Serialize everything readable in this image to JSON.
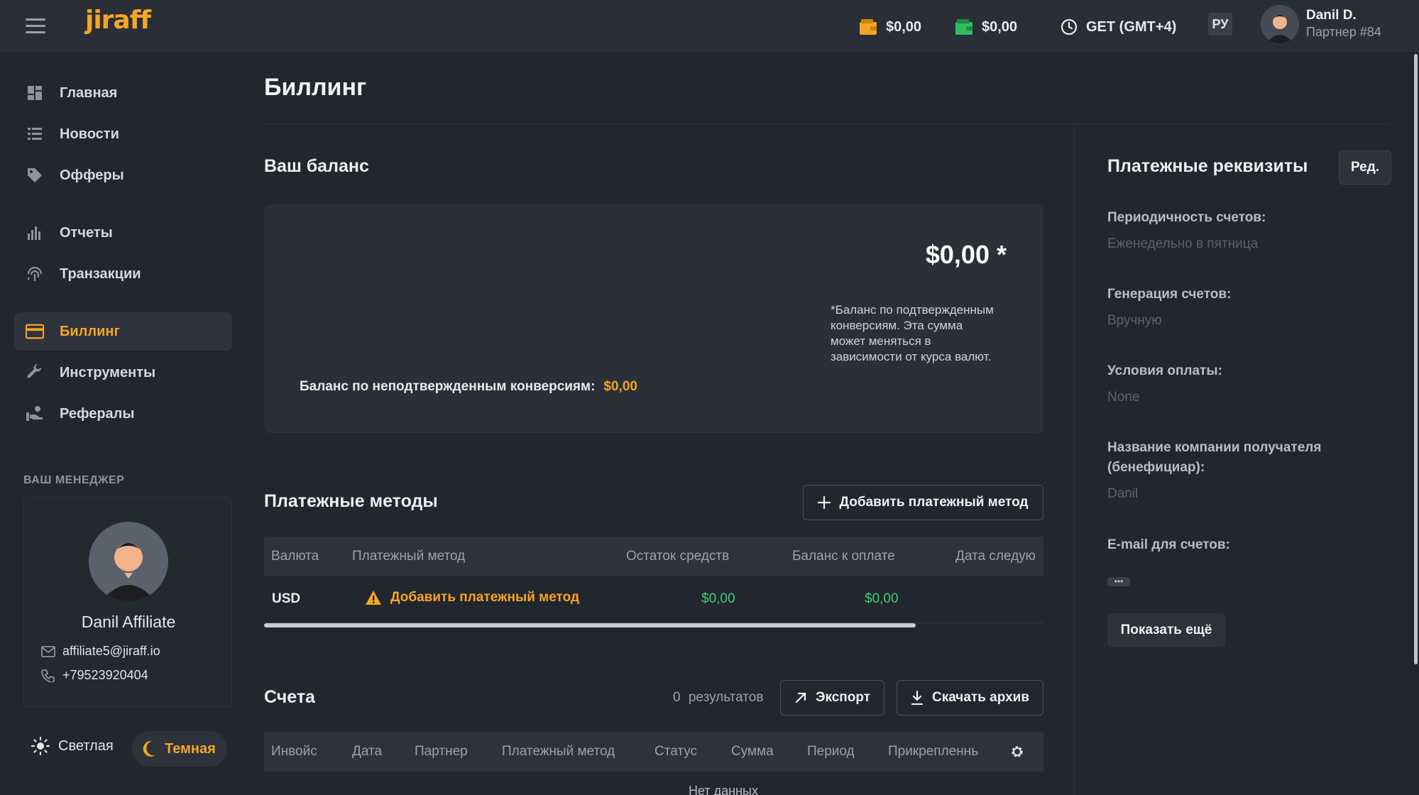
{
  "header": {
    "logo": "jiraff",
    "wallet1_amount": "$0,00",
    "wallet2_amount": "$0,00",
    "timezone": "GET (GMT+4)",
    "lang": "РУ",
    "user_name": "Danil D.",
    "user_role": "Партнер #84"
  },
  "sidebar": {
    "items": [
      {
        "label": "Главная",
        "icon": "dashboard-icon"
      },
      {
        "label": "Новости",
        "icon": "news-icon"
      },
      {
        "label": "Офферы",
        "icon": "tag-icon"
      },
      {
        "label": "Отчеты",
        "icon": "bar-chart-icon"
      },
      {
        "label": "Транзакции",
        "icon": "fingerprint-icon"
      },
      {
        "label": "Биллинг",
        "icon": "credit-card-icon",
        "active": true
      },
      {
        "label": "Инструменты",
        "icon": "wrench-icon"
      },
      {
        "label": "Рефералы",
        "icon": "referral-icon"
      }
    ],
    "manager_title": "ВАШ МЕНЕДЖЕР",
    "manager": {
      "name": "Danil Affiliate",
      "email": "affiliate5@jiraff.io",
      "phone": "+79523920404"
    },
    "theme_light": "Светлая",
    "theme_dark": "Темная"
  },
  "main": {
    "page_title": "Биллинг",
    "balance": {
      "title": "Ваш баланс",
      "amount": "$0,00 *",
      "note": "*Баланс по подтвержденным конверсиям. Эта сумма может меняться в зависимости от курса валют.",
      "unconfirmed_label": "Баланс по неподтвержденным конверсиям:",
      "unconfirmed_value": "$0,00"
    },
    "payment_methods": {
      "title": "Платежные методы",
      "add_button": "Добавить платежный метод",
      "columns": [
        "Валюта",
        "Платежный метод",
        "Остаток средств",
        "Баланс к оплате",
        "Дата следую"
      ],
      "row": {
        "currency": "USD",
        "method": "Добавить платежный метод",
        "remainder": "$0,00",
        "to_pay": "$0,00"
      },
      "scroll_fraction": 0.836
    },
    "invoices": {
      "title": "Счета",
      "results_count": "0",
      "results_label": "результатов",
      "export_button": "Экспорт",
      "download_button": "Скачать архив",
      "columns": [
        "Инвойс",
        "Дата",
        "Партнер",
        "Платежный метод",
        "Статус",
        "Сумма",
        "Период",
        "Прикрепленнь"
      ],
      "empty_text": "Нет данных"
    }
  },
  "requisites": {
    "title": "Платежные реквизиты",
    "edit_button": "Ред.",
    "fields": [
      {
        "label": "Периодичность счетов:",
        "value": "Еженедельно в пятница"
      },
      {
        "label": "Генерация счетов:",
        "value": "Вручную"
      },
      {
        "label": "Условия оплаты:",
        "value": "None"
      },
      {
        "label": "Название компании получателя (бенефициар):",
        "value": "Danil"
      },
      {
        "label": "E-mail для счетов:",
        "value": "•••"
      }
    ],
    "show_more_button": "Показать ещё"
  },
  "colors": {
    "accent": "#f5a623",
    "positive": "#3ecf6e",
    "background": "#22262f"
  }
}
